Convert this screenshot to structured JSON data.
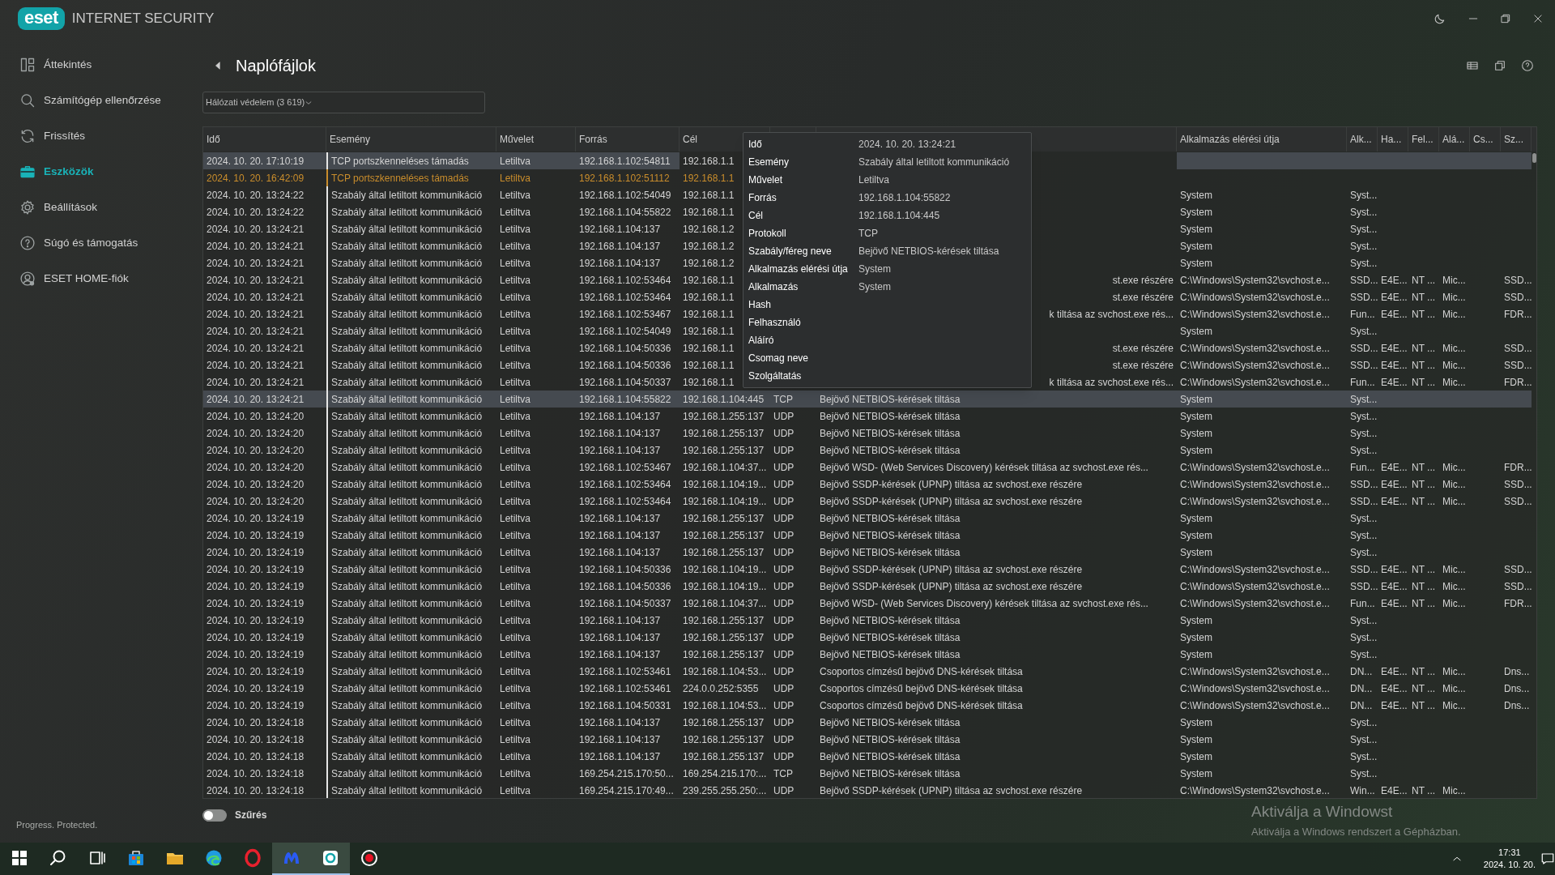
{
  "app": {
    "logo": "eset",
    "product": "INTERNET SECURITY"
  },
  "sidebar": {
    "items": [
      {
        "label": "Áttekintés",
        "kind": "overview",
        "selected": false
      },
      {
        "label": "Számítógép ellenőrzése",
        "kind": "scan",
        "selected": false
      },
      {
        "label": "Frissítés",
        "kind": "update",
        "selected": false
      },
      {
        "label": "Eszközök",
        "kind": "tools",
        "selected": true
      },
      {
        "label": "Beállítások",
        "kind": "settings",
        "selected": false
      },
      {
        "label": "Súgó és támogatás",
        "kind": "help",
        "selected": false
      },
      {
        "label": "ESET HOME-fiók",
        "kind": "account",
        "selected": false
      }
    ],
    "tagline": "Progress. Protected."
  },
  "page": {
    "title": "Naplófájlok",
    "log_select": {
      "value": "Hálózati védelem (3 619)"
    }
  },
  "table": {
    "columns": [
      "Idő",
      "Esemény",
      "Művelet",
      "Forrás",
      "Cél",
      "Alkalmazás elérési útja",
      "Alk...",
      "Ha...",
      "Fel...",
      "Alá...",
      "Cs...",
      "Sz..."
    ],
    "rows": [
      {
        "kind": "normal",
        "selected": true,
        "time": "2024. 10. 20. 17:10:19",
        "event": "TCP portszkenneléses támadás",
        "action": "Letiltva",
        "source": "192.168.1.102:54811",
        "target": "192.168.1.1"
      },
      {
        "kind": "warning",
        "selected": false,
        "time": "2024. 10. 20. 16:42:09",
        "event": "TCP portszkenneléses támadás",
        "action": "Letiltva",
        "source": "192.168.1.102:51112",
        "target": "192.168.1.1"
      },
      {
        "kind": "normal",
        "selected": false,
        "time": "2024. 10. 20. 13:24:22",
        "event": "Szabály által letiltott kommunikáció",
        "action": "Letiltva",
        "source": "192.168.1.102:54049",
        "target": "192.168.1.1",
        "app_path": "System",
        "alk": "Syst..."
      },
      {
        "kind": "normal",
        "selected": false,
        "time": "2024. 10. 20. 13:24:22",
        "event": "Szabály által letiltott kommunikáció",
        "action": "Letiltva",
        "source": "192.168.1.104:55822",
        "target": "192.168.1.1",
        "app_path": "System",
        "alk": "Syst..."
      },
      {
        "kind": "normal",
        "selected": false,
        "time": "2024. 10. 20. 13:24:21",
        "event": "Szabály által letiltott kommunikáció",
        "action": "Letiltva",
        "source": "192.168.1.104:137",
        "target": "192.168.1.2",
        "app_path": "System",
        "alk": "Syst..."
      },
      {
        "kind": "normal",
        "selected": false,
        "time": "2024. 10. 20. 13:24:21",
        "event": "Szabály által letiltott kommunikáció",
        "action": "Letiltva",
        "source": "192.168.1.104:137",
        "target": "192.168.1.2",
        "app_path": "System",
        "alk": "Syst..."
      },
      {
        "kind": "normal",
        "selected": false,
        "time": "2024. 10. 20. 13:24:21",
        "event": "Szabály által letiltott kommunikáció",
        "action": "Letiltva",
        "source": "192.168.1.104:137",
        "target": "192.168.1.2",
        "app_path": "System",
        "alk": "Syst..."
      },
      {
        "kind": "normal",
        "selected": false,
        "time": "2024. 10. 20. 13:24:21",
        "event": "Szabály által letiltott kommunikáció",
        "action": "Letiltva",
        "source": "192.168.1.102:53464",
        "target": "192.168.1.1",
        "rule_visible_end": "st.exe részére",
        "app_path": "C:\\Windows\\System32\\svchost.e...",
        "alk": "SSD...",
        "ha": "E4E...",
        "fel": "NT ...",
        "ala": "Mic...",
        "sz": "SSD..."
      },
      {
        "kind": "normal",
        "selected": false,
        "time": "2024. 10. 20. 13:24:21",
        "event": "Szabály által letiltott kommunikáció",
        "action": "Letiltva",
        "source": "192.168.1.102:53464",
        "target": "192.168.1.1",
        "rule_visible_end": "st.exe részére",
        "app_path": "C:\\Windows\\System32\\svchost.e...",
        "alk": "SSD...",
        "ha": "E4E...",
        "fel": "NT ...",
        "ala": "Mic...",
        "sz": "SSD..."
      },
      {
        "kind": "normal",
        "selected": false,
        "time": "2024. 10. 20. 13:24:21",
        "event": "Szabály által letiltott kommunikáció",
        "action": "Letiltva",
        "source": "192.168.1.102:53467",
        "target": "192.168.1.1",
        "rule_visible_end": "k tiltása az svchost.exe rés...",
        "app_path": "C:\\Windows\\System32\\svchost.e...",
        "alk": "Fun...",
        "ha": "E4E...",
        "fel": "NT ...",
        "ala": "Mic...",
        "sz": "FDR..."
      },
      {
        "kind": "normal",
        "selected": false,
        "time": "2024. 10. 20. 13:24:21",
        "event": "Szabály által letiltott kommunikáció",
        "action": "Letiltva",
        "source": "192.168.1.102:54049",
        "target": "192.168.1.1",
        "app_path": "System",
        "alk": "Syst..."
      },
      {
        "kind": "normal",
        "selected": false,
        "time": "2024. 10. 20. 13:24:21",
        "event": "Szabály által letiltott kommunikáció",
        "action": "Letiltva",
        "source": "192.168.1.104:50336",
        "target": "192.168.1.1",
        "rule_visible_end": "st.exe részére",
        "app_path": "C:\\Windows\\System32\\svchost.e...",
        "alk": "SSD...",
        "ha": "E4E...",
        "fel": "NT ...",
        "ala": "Mic...",
        "sz": "SSD..."
      },
      {
        "kind": "normal",
        "selected": false,
        "time": "2024. 10. 20. 13:24:21",
        "event": "Szabály által letiltott kommunikáció",
        "action": "Letiltva",
        "source": "192.168.1.104:50336",
        "target": "192.168.1.1",
        "rule_visible_end": "st.exe részére",
        "app_path": "C:\\Windows\\System32\\svchost.e...",
        "alk": "SSD...",
        "ha": "E4E...",
        "fel": "NT ...",
        "ala": "Mic...",
        "sz": "SSD..."
      },
      {
        "kind": "normal",
        "selected": false,
        "time": "2024. 10. 20. 13:24:21",
        "event": "Szabály által letiltott kommunikáció",
        "action": "Letiltva",
        "source": "192.168.1.104:50337",
        "target": "192.168.1.1",
        "rule_visible_end": "k tiltása az svchost.exe rés...",
        "app_path": "C:\\Windows\\System32\\svchost.e...",
        "alk": "Fun...",
        "ha": "E4E...",
        "fel": "NT ...",
        "ala": "Mic...",
        "sz": "FDR..."
      },
      {
        "kind": "normal",
        "selected": true,
        "time": "2024. 10. 20. 13:24:21",
        "event": "Szabály által letiltott kommunikáció",
        "action": "Letiltva",
        "source": "192.168.1.104:55822",
        "target": "192.168.1.104:445",
        "protocol": "TCP",
        "rule": "Bejövő NETBIOS-kérések tiltása",
        "app_path": "System",
        "alk": "Syst..."
      },
      {
        "kind": "normal",
        "selected": false,
        "time": "2024. 10. 20. 13:24:20",
        "event": "Szabály által letiltott kommunikáció",
        "action": "Letiltva",
        "source": "192.168.1.104:137",
        "target": "192.168.1.255:137",
        "protocol": "UDP",
        "rule": "Bejövő NETBIOS-kérések tiltása",
        "app_path": "System",
        "alk": "Syst..."
      },
      {
        "kind": "normal",
        "selected": false,
        "time": "2024. 10. 20. 13:24:20",
        "event": "Szabály által letiltott kommunikáció",
        "action": "Letiltva",
        "source": "192.168.1.104:137",
        "target": "192.168.1.255:137",
        "protocol": "UDP",
        "rule": "Bejövő NETBIOS-kérések tiltása",
        "app_path": "System",
        "alk": "Syst..."
      },
      {
        "kind": "normal",
        "selected": false,
        "time": "2024. 10. 20. 13:24:20",
        "event": "Szabály által letiltott kommunikáció",
        "action": "Letiltva",
        "source": "192.168.1.104:137",
        "target": "192.168.1.255:137",
        "protocol": "UDP",
        "rule": "Bejövő NETBIOS-kérések tiltása",
        "app_path": "System",
        "alk": "Syst..."
      },
      {
        "kind": "normal",
        "selected": false,
        "time": "2024. 10. 20. 13:24:20",
        "event": "Szabály által letiltott kommunikáció",
        "action": "Letiltva",
        "source": "192.168.1.102:53467",
        "target": "192.168.1.104:37...",
        "protocol": "UDP",
        "rule": "Bejövő WSD- (Web Services Discovery) kérések tiltása az svchost.exe rés...",
        "app_path": "C:\\Windows\\System32\\svchost.e...",
        "alk": "Fun...",
        "ha": "E4E...",
        "fel": "NT ...",
        "ala": "Mic...",
        "sz": "FDR..."
      },
      {
        "kind": "normal",
        "selected": false,
        "time": "2024. 10. 20. 13:24:20",
        "event": "Szabály által letiltott kommunikáció",
        "action": "Letiltva",
        "source": "192.168.1.102:53464",
        "target": "192.168.1.104:19...",
        "protocol": "UDP",
        "rule": "Bejövő SSDP-kérések (UPNP) tiltása az svchost.exe részére",
        "app_path": "C:\\Windows\\System32\\svchost.e...",
        "alk": "SSD...",
        "ha": "E4E...",
        "fel": "NT ...",
        "ala": "Mic...",
        "sz": "SSD..."
      },
      {
        "kind": "normal",
        "selected": false,
        "time": "2024. 10. 20. 13:24:20",
        "event": "Szabály által letiltott kommunikáció",
        "action": "Letiltva",
        "source": "192.168.1.102:53464",
        "target": "192.168.1.104:19...",
        "protocol": "UDP",
        "rule": "Bejövő SSDP-kérések (UPNP) tiltása az svchost.exe részére",
        "app_path": "C:\\Windows\\System32\\svchost.e...",
        "alk": "SSD...",
        "ha": "E4E...",
        "fel": "NT ...",
        "ala": "Mic...",
        "sz": "SSD..."
      },
      {
        "kind": "normal",
        "selected": false,
        "time": "2024. 10. 20. 13:24:19",
        "event": "Szabály által letiltott kommunikáció",
        "action": "Letiltva",
        "source": "192.168.1.104:137",
        "target": "192.168.1.255:137",
        "protocol": "UDP",
        "rule": "Bejövő NETBIOS-kérések tiltása",
        "app_path": "System",
        "alk": "Syst..."
      },
      {
        "kind": "normal",
        "selected": false,
        "time": "2024. 10. 20. 13:24:19",
        "event": "Szabály által letiltott kommunikáció",
        "action": "Letiltva",
        "source": "192.168.1.104:137",
        "target": "192.168.1.255:137",
        "protocol": "UDP",
        "rule": "Bejövő NETBIOS-kérések tiltása",
        "app_path": "System",
        "alk": "Syst..."
      },
      {
        "kind": "normal",
        "selected": false,
        "time": "2024. 10. 20. 13:24:19",
        "event": "Szabály által letiltott kommunikáció",
        "action": "Letiltva",
        "source": "192.168.1.104:137",
        "target": "192.168.1.255:137",
        "protocol": "UDP",
        "rule": "Bejövő NETBIOS-kérések tiltása",
        "app_path": "System",
        "alk": "Syst..."
      },
      {
        "kind": "normal",
        "selected": false,
        "time": "2024. 10. 20. 13:24:19",
        "event": "Szabály által letiltott kommunikáció",
        "action": "Letiltva",
        "source": "192.168.1.104:50336",
        "target": "192.168.1.104:19...",
        "protocol": "UDP",
        "rule": "Bejövő SSDP-kérések (UPNP) tiltása az svchost.exe részére",
        "app_path": "C:\\Windows\\System32\\svchost.e...",
        "alk": "SSD...",
        "ha": "E4E...",
        "fel": "NT ...",
        "ala": "Mic...",
        "sz": "SSD..."
      },
      {
        "kind": "normal",
        "selected": false,
        "time": "2024. 10. 20. 13:24:19",
        "event": "Szabály által letiltott kommunikáció",
        "action": "Letiltva",
        "source": "192.168.1.104:50336",
        "target": "192.168.1.104:19...",
        "protocol": "UDP",
        "rule": "Bejövő SSDP-kérések (UPNP) tiltása az svchost.exe részére",
        "app_path": "C:\\Windows\\System32\\svchost.e...",
        "alk": "SSD...",
        "ha": "E4E...",
        "fel": "NT ...",
        "ala": "Mic...",
        "sz": "SSD..."
      },
      {
        "kind": "normal",
        "selected": false,
        "time": "2024. 10. 20. 13:24:19",
        "event": "Szabály által letiltott kommunikáció",
        "action": "Letiltva",
        "source": "192.168.1.104:50337",
        "target": "192.168.1.104:37...",
        "protocol": "UDP",
        "rule": "Bejövő WSD- (Web Services Discovery) kérések tiltása az svchost.exe rés...",
        "app_path": "C:\\Windows\\System32\\svchost.e...",
        "alk": "Fun...",
        "ha": "E4E...",
        "fel": "NT ...",
        "ala": "Mic...",
        "sz": "FDR..."
      },
      {
        "kind": "normal",
        "selected": false,
        "time": "2024. 10. 20. 13:24:19",
        "event": "Szabály által letiltott kommunikáció",
        "action": "Letiltva",
        "source": "192.168.1.104:137",
        "target": "192.168.1.255:137",
        "protocol": "UDP",
        "rule": "Bejövő NETBIOS-kérések tiltása",
        "app_path": "System",
        "alk": "Syst..."
      },
      {
        "kind": "normal",
        "selected": false,
        "time": "2024. 10. 20. 13:24:19",
        "event": "Szabály által letiltott kommunikáció",
        "action": "Letiltva",
        "source": "192.168.1.104:137",
        "target": "192.168.1.255:137",
        "protocol": "UDP",
        "rule": "Bejövő NETBIOS-kérések tiltása",
        "app_path": "System",
        "alk": "Syst..."
      },
      {
        "kind": "normal",
        "selected": false,
        "time": "2024. 10. 20. 13:24:19",
        "event": "Szabály által letiltott kommunikáció",
        "action": "Letiltva",
        "source": "192.168.1.104:137",
        "target": "192.168.1.255:137",
        "protocol": "UDP",
        "rule": "Bejövő NETBIOS-kérések tiltása",
        "app_path": "System",
        "alk": "Syst..."
      },
      {
        "kind": "normal",
        "selected": false,
        "time": "2024. 10. 20. 13:24:19",
        "event": "Szabály által letiltott kommunikáció",
        "action": "Letiltva",
        "source": "192.168.1.102:53461",
        "target": "192.168.1.104:53...",
        "protocol": "UDP",
        "rule": "Csoportos címzésű bejövő DNS-kérések tiltása",
        "app_path": "C:\\Windows\\System32\\svchost.e...",
        "alk": "DN...",
        "ha": "E4E...",
        "fel": "NT ...",
        "ala": "Mic...",
        "sz": "Dns..."
      },
      {
        "kind": "normal",
        "selected": false,
        "time": "2024. 10. 20. 13:24:19",
        "event": "Szabály által letiltott kommunikáció",
        "action": "Letiltva",
        "source": "192.168.1.102:53461",
        "target": "224.0.0.252:5355",
        "protocol": "UDP",
        "rule": "Csoportos címzésű bejövő DNS-kérések tiltása",
        "app_path": "C:\\Windows\\System32\\svchost.e...",
        "alk": "DN...",
        "ha": "E4E...",
        "fel": "NT ...",
        "ala": "Mic...",
        "sz": "Dns..."
      },
      {
        "kind": "normal",
        "selected": false,
        "time": "2024. 10. 20. 13:24:19",
        "event": "Szabály által letiltott kommunikáció",
        "action": "Letiltva",
        "source": "192.168.1.104:50331",
        "target": "192.168.1.104:53...",
        "protocol": "UDP",
        "rule": "Csoportos címzésű bejövő DNS-kérések tiltása",
        "app_path": "C:\\Windows\\System32\\svchost.e...",
        "alk": "DN...",
        "ha": "E4E...",
        "fel": "NT ...",
        "ala": "Mic...",
        "sz": "Dns..."
      },
      {
        "kind": "normal",
        "selected": false,
        "time": "2024. 10. 20. 13:24:18",
        "event": "Szabály által letiltott kommunikáció",
        "action": "Letiltva",
        "source": "192.168.1.104:137",
        "target": "192.168.1.255:137",
        "protocol": "UDP",
        "rule": "Bejövő NETBIOS-kérések tiltása",
        "app_path": "System",
        "alk": "Syst..."
      },
      {
        "kind": "normal",
        "selected": false,
        "time": "2024. 10. 20. 13:24:18",
        "event": "Szabály által letiltott kommunikáció",
        "action": "Letiltva",
        "source": "192.168.1.104:137",
        "target": "192.168.1.255:137",
        "protocol": "UDP",
        "rule": "Bejövő NETBIOS-kérések tiltása",
        "app_path": "System",
        "alk": "Syst..."
      },
      {
        "kind": "normal",
        "selected": false,
        "time": "2024. 10. 20. 13:24:18",
        "event": "Szabály által letiltott kommunikáció",
        "action": "Letiltva",
        "source": "192.168.1.104:137",
        "target": "192.168.1.255:137",
        "protocol": "UDP",
        "rule": "Bejövő NETBIOS-kérések tiltása",
        "app_path": "System",
        "alk": "Syst..."
      },
      {
        "kind": "normal",
        "selected": false,
        "time": "2024. 10. 20. 13:24:18",
        "event": "Szabály által letiltott kommunikáció",
        "action": "Letiltva",
        "source": "169.254.215.170:50...",
        "target": "169.254.215.170:...",
        "protocol": "TCP",
        "rule": "Bejövő NETBIOS-kérések tiltása",
        "app_path": "System",
        "alk": "Syst..."
      },
      {
        "kind": "normal",
        "selected": false,
        "time": "2024. 10. 20. 13:24:18",
        "event": "Szabály által letiltott kommunikáció",
        "action": "Letiltva",
        "source": "169.254.215.170:49...",
        "target": "239.255.255.250:...",
        "protocol": "UDP",
        "rule": "Bejövő SSDP-kérések (UPNP) tiltása az svchost.exe részére",
        "app_path": "C:\\Windows\\System32\\svchost.e...",
        "alk": "Win...",
        "ha": "E4E...",
        "fel": "NT ...",
        "ala": "Mic..."
      }
    ]
  },
  "tooltip": [
    {
      "label": "Idő",
      "value": "2024. 10. 20. 13:24:21"
    },
    {
      "label": "Esemény",
      "value": "Szabály által letiltott kommunikáció"
    },
    {
      "label": "Művelet",
      "value": "Letiltva"
    },
    {
      "label": "Forrás",
      "value": "192.168.1.104:55822"
    },
    {
      "label": "Cél",
      "value": "192.168.1.104:445"
    },
    {
      "label": "Protokoll",
      "value": "TCP"
    },
    {
      "label": "Szabály/féreg neve",
      "value": "Bejövő NETBIOS-kérések tiltása"
    },
    {
      "label": "Alkalmazás elérési útja",
      "value": "System"
    },
    {
      "label": "Alkalmazás",
      "value": "System"
    },
    {
      "label": "Hash"
    },
    {
      "label": "Felhasználó"
    },
    {
      "label": "Aláíró"
    },
    {
      "label": "Csomag neve"
    },
    {
      "label": "Szolgáltatás"
    }
  ],
  "filter": {
    "label": "Szűrés",
    "on": false
  },
  "windows_activation": {
    "title": "Aktiválja a Windowst",
    "text": "Aktiválja a Windows rendszert a Gépházban."
  },
  "taskbar": {
    "icons": [
      {
        "kind": "start",
        "active": false
      },
      {
        "kind": "search",
        "active": false
      },
      {
        "kind": "taskview",
        "active": false
      },
      {
        "kind": "store",
        "active": false
      },
      {
        "kind": "folder",
        "active": false
      },
      {
        "kind": "swirl",
        "active": false
      },
      {
        "kind": "ring",
        "active": false
      },
      {
        "kind": "mlogo",
        "active": true
      },
      {
        "kind": "elogo",
        "active": true
      },
      {
        "kind": "record",
        "active": false
      }
    ],
    "time": "17:31",
    "date": "2024. 10. 20."
  }
}
